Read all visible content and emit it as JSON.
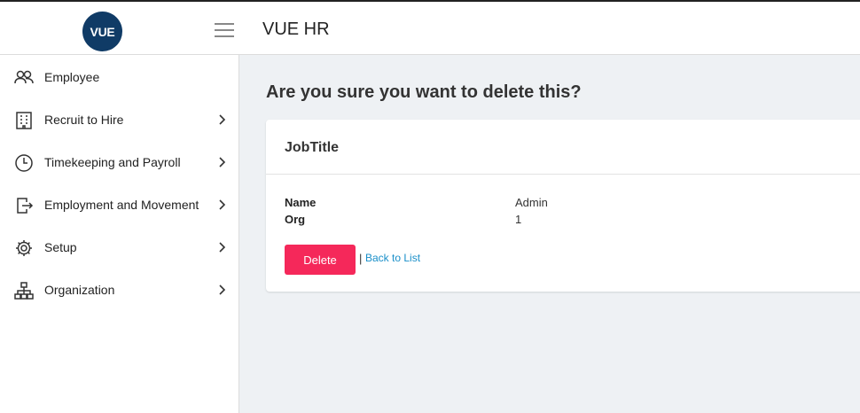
{
  "header": {
    "logo_text": "VUE",
    "app_title": "VUE HR"
  },
  "sidebar": {
    "items": [
      {
        "label": "Employee",
        "icon": "people-icon",
        "has_chevron": false
      },
      {
        "label": "Recruit to Hire",
        "icon": "building-icon",
        "has_chevron": true
      },
      {
        "label": "Timekeeping and Payroll",
        "icon": "clock-icon",
        "has_chevron": true
      },
      {
        "label": "Employment and Movement",
        "icon": "exit-icon",
        "has_chevron": true
      },
      {
        "label": "Setup",
        "icon": "gear-icon",
        "has_chevron": true
      },
      {
        "label": "Organization",
        "icon": "org-chart-icon",
        "has_chevron": true
      }
    ]
  },
  "main": {
    "heading": "Are you sure you want to delete this?",
    "card_title": "JobTitle",
    "fields": [
      {
        "label": "Name",
        "value": "Admin"
      },
      {
        "label": "Org",
        "value": "1"
      }
    ],
    "delete_label": "Delete",
    "separator": "|",
    "back_label": "Back to List"
  },
  "colors": {
    "logo_bg": "#103b66",
    "delete_bg": "#f5285a",
    "link": "#1a8fc9",
    "main_bg": "#eef1f4"
  }
}
